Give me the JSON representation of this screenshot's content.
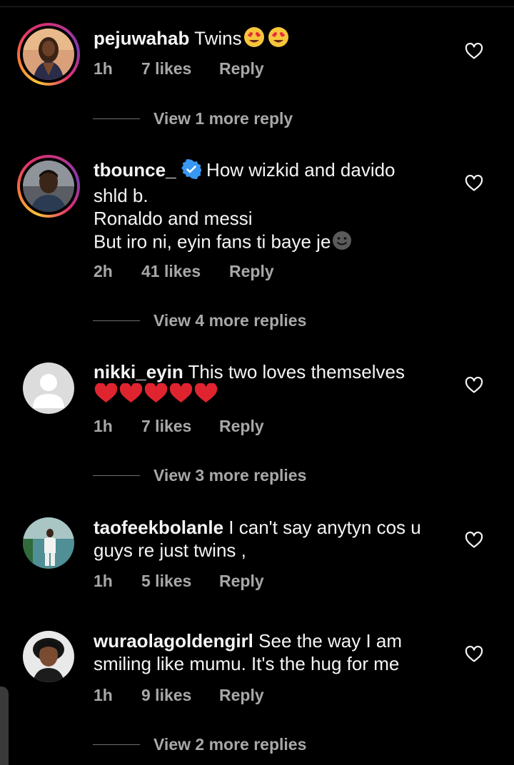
{
  "comments": [
    {
      "username": "pejuwahab",
      "text": "Twins",
      "emojis": [
        "heart-eyes-emoji",
        "heart-eyes-emoji"
      ],
      "time": "1h",
      "likes": "7 likes",
      "reply": "Reply",
      "view_replies": "View 1 more reply",
      "avatar_ring": true
    },
    {
      "username": "tbounce_",
      "verified": true,
      "text_lines": [
        "How wizkid and davido",
        "shld b.",
        "Ronaldo and messi",
        "But iro ni, eyin fans ti baye je"
      ],
      "emojis": [
        "slightly-smiling-face-emoji"
      ],
      "time": "2h",
      "likes": "41 likes",
      "reply": "Reply",
      "view_replies": "View 4 more replies",
      "avatar_ring": true
    },
    {
      "username": "nikki_eyin",
      "text": "This two loves themselves",
      "emojis": [
        "red-heart-emoji",
        "red-heart-emoji",
        "red-heart-emoji",
        "red-heart-emoji",
        "red-heart-emoji"
      ],
      "time": "1h",
      "likes": "7 likes",
      "reply": "Reply",
      "view_replies": "View 3 more replies",
      "avatar_ring": false
    },
    {
      "username": "taofeekbolanle",
      "text_lines": [
        "I can't say anytyn cos u",
        "guys re just twins ,"
      ],
      "time": "1h",
      "likes": "5 likes",
      "reply": "Reply",
      "avatar_ring": false
    },
    {
      "username": "wuraolagoldengirl",
      "text_lines": [
        "See the way I am",
        "smiling like mumu. It's the hug for me"
      ],
      "time": "1h",
      "likes": "9 likes",
      "reply": "Reply",
      "view_replies": "View 2 more replies",
      "avatar_ring": false
    }
  ],
  "colors": {
    "background": "#000000",
    "primary_text": "#f5f5f5",
    "secondary_text": "#a8a8a8",
    "verified_badge": "#3897f0",
    "heart_emoji": "#e0242f"
  }
}
